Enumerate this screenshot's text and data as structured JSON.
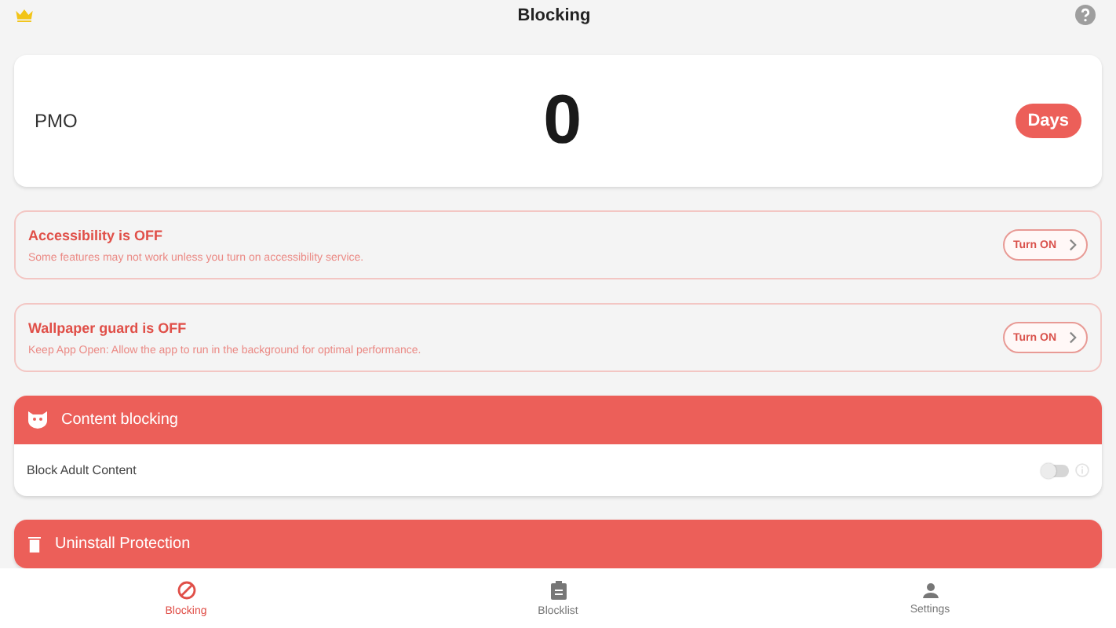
{
  "header": {
    "title": "Blocking"
  },
  "counter": {
    "name": "PMO",
    "value": "0",
    "unit": "Days"
  },
  "alerts": [
    {
      "title": "Accessibility is OFF",
      "text": "Some features may not work unless you turn on accessibility service.",
      "button": "Turn ON"
    },
    {
      "title": "Wallpaper guard is OFF",
      "text": "Keep App Open: Allow the app to run in the background for optimal performance.",
      "button": "Turn ON"
    }
  ],
  "sections": [
    {
      "kind": "mask",
      "title": "Content blocking",
      "items": [
        {
          "label": "Block Adult Content",
          "on": false
        }
      ]
    },
    {
      "kind": "trash",
      "title": "Uninstall Protection"
    }
  ],
  "nav": [
    {
      "label": "Blocking",
      "selected": true
    },
    {
      "label": "Blocklist",
      "selected": false
    },
    {
      "label": "Settings",
      "selected": false
    }
  ]
}
